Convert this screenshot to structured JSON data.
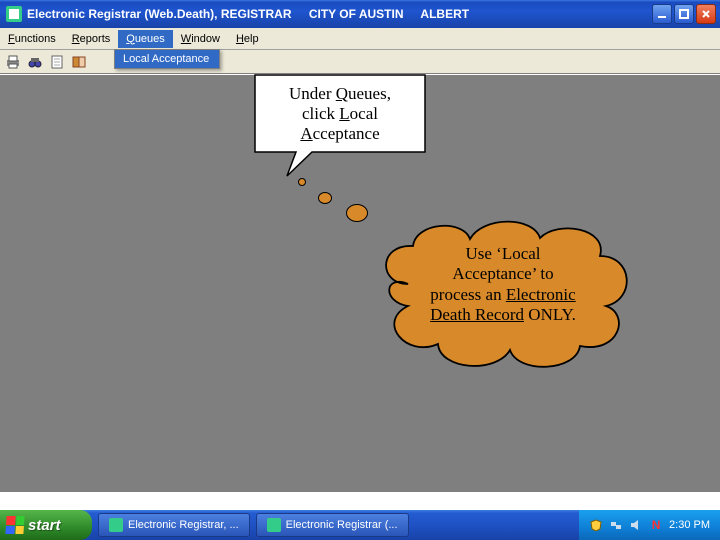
{
  "titlebar": {
    "app": "Electronic Registrar (Web.Death), REGISTRAR",
    "org": "CITY OF AUSTIN",
    "user": "ALBERT"
  },
  "menu": {
    "functions": "Functions",
    "reports": "Reports",
    "queues": "Queues",
    "window": "Window",
    "help": "Help"
  },
  "dropdown": {
    "local_acceptance": "Local Acceptance"
  },
  "callout": {
    "line1_prefix": "Under ",
    "line1_underlined": "Q",
    "line1_suffix": "ueues,",
    "line2_prefix": "click ",
    "line2_underlined": "L",
    "line2_suffix": "ocal",
    "line3_underlined": "A",
    "line3_suffix": "cceptance"
  },
  "cloud": {
    "line1": "Use ‘Local",
    "line2": "Acceptance’ to",
    "line3_prefix": "process an ",
    "line3_u": "Electronic",
    "line4_u": "Death Record",
    "line4_suffix": " ONLY.",
    "fill": "#d88a2a"
  },
  "taskbar": {
    "start": "start",
    "item1": "Electronic Registrar, ...",
    "item2": "Electronic Registrar (...",
    "clock": "2:30 PM"
  },
  "icons": {
    "print": "print-icon",
    "binoculars": "binoculars-icon",
    "doc": "document-icon",
    "book": "book-icon"
  }
}
